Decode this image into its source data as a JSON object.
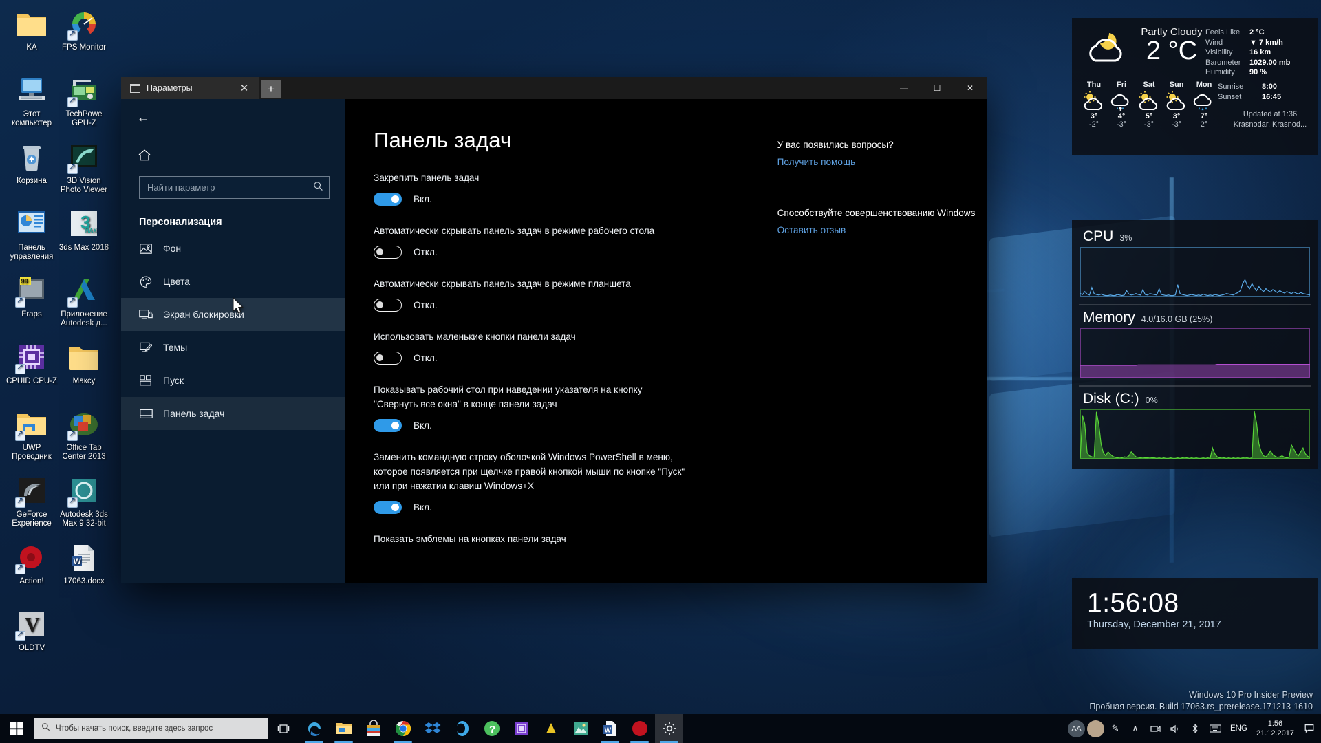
{
  "desktop": {
    "icons": [
      {
        "label": "KA",
        "icon": "folder-icon"
      },
      {
        "label": "FPS Monitor",
        "icon": "fps-monitor-icon"
      },
      {
        "label": "Этот компьютер",
        "icon": "this-pc-icon"
      },
      {
        "label": "TechPowe GPU-Z",
        "icon": "gpuz-icon"
      },
      {
        "label": "Корзина",
        "icon": "recycle-bin-icon"
      },
      {
        "label": "3D Vision Photo Viewer",
        "icon": "3d-vision-icon"
      },
      {
        "label": "Панель управления",
        "icon": "control-panel-icon"
      },
      {
        "label": "3ds Max 2018",
        "icon": "3dsmax-2018-icon"
      },
      {
        "label": "Fraps",
        "icon": "fraps-icon"
      },
      {
        "label": "Приложение Autodesk д...",
        "icon": "autodesk-app-icon"
      },
      {
        "label": "CPUID CPU-Z",
        "icon": "cpuz-icon"
      },
      {
        "label": "Максу",
        "icon": "folder-icon"
      },
      {
        "label": "UWP Проводник",
        "icon": "uwp-explorer-icon"
      },
      {
        "label": "Office Tab Center 2013",
        "icon": "office-tab-icon"
      },
      {
        "label": "GeForce Experience",
        "icon": "geforce-experience-icon"
      },
      {
        "label": "Autodesk 3ds Max 9 32-bit",
        "icon": "3dsmax9-icon"
      },
      {
        "label": "Action!",
        "icon": "action-icon"
      },
      {
        "label": "17063.docx",
        "icon": "word-doc-icon"
      },
      {
        "label": "OLDTV",
        "icon": "oldtv-icon"
      }
    ],
    "watermark_line1": "Windows 10 Pro Insider Preview",
    "watermark_line2": "Пробная версия. Build 17063.rs_prerelease.171213-1610"
  },
  "settings_window": {
    "tab_title": "Параметры",
    "tab_close_label": "✕",
    "new_tab_label": "+",
    "minimize_label": "—",
    "maximize_label": "☐",
    "close_label": "✕",
    "back_label": "←",
    "home_label": "home-icon",
    "search": {
      "placeholder": "Найти параметр",
      "value": ""
    },
    "nav": {
      "section": "Персонализация",
      "items": [
        {
          "label": "Фон",
          "icon": "picture-icon",
          "state": "normal"
        },
        {
          "label": "Цвета",
          "icon": "palette-icon",
          "state": "normal"
        },
        {
          "label": "Экран блокировки",
          "icon": "lock-screen-icon",
          "state": "hover"
        },
        {
          "label": "Темы",
          "icon": "themes-icon",
          "state": "normal"
        },
        {
          "label": "Пуск",
          "icon": "start-tiles-icon",
          "state": "normal"
        },
        {
          "label": "Панель задач",
          "icon": "taskbar-icon",
          "state": "selected"
        }
      ]
    },
    "page_title": "Панель задач",
    "settings": [
      {
        "label": "Закрепить панель задач",
        "state": "on",
        "state_text": "Вкл."
      },
      {
        "label": "Автоматически скрывать панель задач в режиме рабочего стола",
        "state": "off",
        "state_text": "Откл."
      },
      {
        "label": "Автоматически скрывать панель задач в режиме планшета",
        "state": "off",
        "state_text": "Откл."
      },
      {
        "label": "Использовать маленькие кнопки панели задач",
        "state": "off",
        "state_text": "Откл."
      },
      {
        "label": "Показывать рабочий стол при наведении указателя на кнопку \"Свернуть все окна\" в конце панели задач",
        "state": "on",
        "state_text": "Вкл."
      },
      {
        "label": "Заменить командную строку оболочкой Windows PowerShell в меню, которое появляется при щелчке правой кнопкой мыши по кнопке \"Пуск\" или при нажатии клавиш Windows+X",
        "state": "on",
        "state_text": "Вкл."
      },
      {
        "label": "Показать эмблемы на кнопках панели задач",
        "state": "on",
        "state_text": ""
      }
    ],
    "aside": {
      "help_heading": "У вас появились вопросы?",
      "help_link": "Получить помощь",
      "feedback_heading": "Способствуйте совершенствованию Windows",
      "feedback_link": "Оставить отзыв"
    },
    "accent_color": "#2f9ae8",
    "link_color": "#5ea0e0"
  },
  "weather": {
    "condition": "Partly Cloudy",
    "temperature": "2 °C",
    "stats": [
      {
        "key": "Feels Like",
        "value": "2 °C"
      },
      {
        "key": "Wind",
        "value": "▼ 7 km/h"
      },
      {
        "key": "Visibility",
        "value": "16 km"
      },
      {
        "key": "Barometer",
        "value": "1029.00 mb"
      },
      {
        "key": "Humidity",
        "value": "90 %"
      }
    ],
    "forecast": [
      {
        "day": "Thu",
        "icon": "sun-cloud-icon",
        "high": "3°",
        "low": "-2°"
      },
      {
        "day": "Fri",
        "icon": "cloud-snow-icon",
        "high": "4°",
        "low": "-3°"
      },
      {
        "day": "Sat",
        "icon": "sun-cloud-icon",
        "high": "5°",
        "low": "-3°"
      },
      {
        "day": "Sun",
        "icon": "sun-cloud-icon",
        "high": "3°",
        "low": "-3°"
      },
      {
        "day": "Mon",
        "icon": "cloud-rain-icon",
        "high": "7°",
        "low": "2°"
      }
    ],
    "sun": [
      {
        "key": "Sunrise",
        "value": "8:00"
      },
      {
        "key": "Sunset",
        "value": "16:45"
      }
    ],
    "updated": "Updated at 1:36",
    "location": "Krasnodar, Krasnod..."
  },
  "perf": {
    "cpu": {
      "name": "CPU",
      "value": "3%",
      "color": "#5aa9e6"
    },
    "memory": {
      "name": "Memory",
      "value": "4.0/16.0 GB (25%)",
      "color": "#b44fd0"
    },
    "disk": {
      "name": "Disk (C:)",
      "value": "0%",
      "color": "#59d637"
    }
  },
  "chart_data": [
    {
      "type": "line",
      "title": "CPU",
      "ylabel": "%",
      "ylim": [
        0,
        100
      ],
      "grid": false,
      "values": [
        6,
        4,
        10,
        5,
        3,
        18,
        6,
        4,
        3,
        5,
        3,
        2,
        2,
        3,
        2,
        2,
        4,
        3,
        2,
        3,
        12,
        5,
        3,
        4,
        6,
        4,
        3,
        14,
        4,
        3,
        6,
        5,
        4,
        3,
        16,
        4,
        3,
        2,
        3,
        2,
        2,
        3,
        24,
        6,
        4,
        3,
        2,
        3,
        4,
        3,
        2,
        3,
        2,
        5,
        3,
        2,
        3,
        2,
        4,
        3,
        2,
        3,
        4,
        6,
        5,
        4,
        3,
        6,
        8,
        12,
        26,
        34,
        22,
        16,
        26,
        18,
        12,
        20,
        14,
        10,
        16,
        12,
        9,
        14,
        11,
        8,
        12,
        9,
        7,
        10,
        8,
        6,
        9,
        7,
        5,
        8,
        6,
        5,
        4,
        3
      ]
    },
    {
      "type": "line",
      "title": "Memory",
      "ylabel": "%",
      "ylim": [
        0,
        100
      ],
      "grid": false,
      "values": [
        25,
        25,
        25,
        25,
        25,
        25,
        25,
        25,
        25,
        25,
        25,
        25,
        25,
        25,
        25,
        25,
        25,
        25,
        25,
        25,
        25,
        25,
        25,
        25,
        25,
        26,
        26,
        26,
        26,
        26,
        26,
        26,
        26,
        26,
        26,
        26,
        26,
        26,
        26,
        26,
        26,
        26,
        26,
        26,
        26,
        26,
        26,
        26,
        26,
        26,
        26,
        26,
        26,
        26,
        26,
        26,
        26,
        26,
        26,
        27,
        27,
        27,
        27,
        27,
        27,
        27,
        27,
        27,
        27,
        27,
        27,
        27,
        27,
        27,
        27,
        27,
        27,
        27,
        27,
        27,
        27,
        27,
        27,
        27,
        27,
        27,
        27,
        27,
        27,
        27,
        27,
        27,
        27,
        27,
        27,
        27,
        27,
        27,
        27,
        27
      ]
    },
    {
      "type": "line",
      "title": "Disk (C:)",
      "ylabel": "%",
      "ylim": [
        0,
        100
      ],
      "grid": false,
      "values": [
        2,
        88,
        70,
        12,
        6,
        4,
        3,
        95,
        70,
        30,
        12,
        6,
        14,
        9,
        5,
        3,
        2,
        3,
        2,
        4,
        3,
        6,
        14,
        9,
        4,
        3,
        2,
        3,
        2,
        2,
        3,
        2,
        2,
        1,
        2,
        1,
        2,
        1,
        1,
        2,
        1,
        1,
        2,
        1,
        2,
        3,
        2,
        1,
        2,
        1,
        2,
        1,
        1,
        2,
        1,
        2,
        1,
        22,
        10,
        4,
        2,
        3,
        2,
        1,
        2,
        1,
        2,
        1,
        2,
        1,
        2,
        3,
        2,
        1,
        2,
        96,
        72,
        30,
        14,
        6,
        4,
        9,
        16,
        8,
        5,
        3,
        4,
        6,
        3,
        2,
        3,
        28,
        20,
        10,
        6,
        14,
        22,
        10,
        5,
        3
      ]
    }
  ],
  "clock": {
    "time": "1:56:08",
    "date": "Thursday, December 21, 2017"
  },
  "taskbar": {
    "start_label": "start-icon",
    "search_placeholder": "Чтобы начать поиск, введите здесь запрос",
    "task_view_label": "task-view-icon",
    "apps": [
      {
        "name": "edge-icon",
        "running": true,
        "active": false
      },
      {
        "name": "file-explorer-icon",
        "running": true,
        "active": false
      },
      {
        "name": "microsoft-store-icon",
        "running": false,
        "active": false
      },
      {
        "name": "chrome-icon",
        "running": true,
        "active": false
      },
      {
        "name": "dropbox-icon",
        "running": false,
        "active": false
      },
      {
        "name": "cortana-icon",
        "running": false,
        "active": false
      },
      {
        "name": "help-icon",
        "running": false,
        "active": false
      },
      {
        "name": "cpuz-icon",
        "running": false,
        "active": false
      },
      {
        "name": "fraps-icon",
        "running": false,
        "active": false
      },
      {
        "name": "photos-icon",
        "running": false,
        "active": false
      },
      {
        "name": "word-icon",
        "running": true,
        "active": false
      },
      {
        "name": "action-recorder-icon",
        "running": true,
        "active": false
      },
      {
        "name": "settings-gear-icon",
        "running": true,
        "active": true
      }
    ],
    "tray": {
      "badge": "AA",
      "pen_icon": "pen-icon",
      "chevron": "∧",
      "icons": [
        "network-icon",
        "volume-icon",
        "bluetooth-icon",
        "keyboard-icon"
      ],
      "language": "ENG",
      "time": "1:56",
      "date": "21.12.2017",
      "notifications": "notification-icon"
    }
  }
}
